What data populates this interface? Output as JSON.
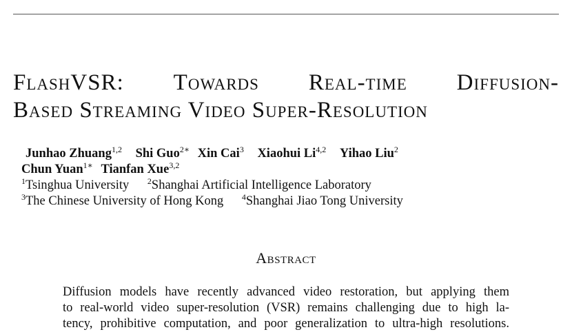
{
  "title": {
    "line1": [
      "FlashVSR:",
      "Towards",
      "Real-time",
      "Diffusion-"
    ],
    "line2": "Based Streaming Video Super-Resolution"
  },
  "authors": [
    {
      "name": "Junhao Zhuang",
      "sup": "1,2"
    },
    {
      "name": "Shi Guo",
      "sup": "2∗"
    },
    {
      "name": "Xin Cai",
      "sup": "3"
    },
    {
      "name": "Xiaohui Li",
      "sup": "4,2"
    },
    {
      "name": "Yihao Liu",
      "sup": "2"
    },
    {
      "name": "Chun Yuan",
      "sup": "1∗"
    },
    {
      "name": "Tianfan Xue",
      "sup": "3,2"
    }
  ],
  "affiliations": [
    {
      "sup": "1",
      "name": "Tsinghua University"
    },
    {
      "sup": "2",
      "name": "Shanghai Artificial Intelligence Laboratory"
    },
    {
      "sup": "3",
      "name": "The Chinese University of Hong Kong"
    },
    {
      "sup": "4",
      "name": "Shanghai Jiao Tong University"
    }
  ],
  "abstract": {
    "heading": "Abstract",
    "lines": [
      "Diffusion models have recently advanced video restoration, but applying them",
      "to real-world video super-resolution (VSR) remains challenging due to high la-",
      "tency, prohibitive computation, and poor generalization to ultra-high resolutions."
    ]
  }
}
